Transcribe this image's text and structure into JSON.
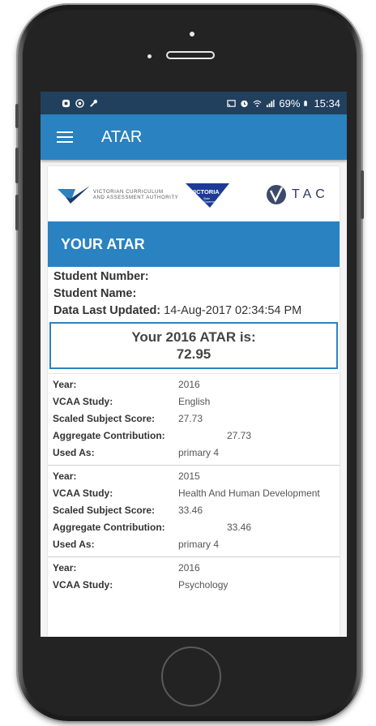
{
  "status_bar": {
    "battery": "69%",
    "time": "15:34"
  },
  "app_bar": {
    "title": "ATAR"
  },
  "logos": {
    "vcaa_line1": "VICTORIAN CURRICULUM",
    "vcaa_line2": "AND ASSESSMENT AUTHORITY",
    "victoria": "VICTORIA",
    "victoria_sub1": "State",
    "victoria_sub2": "Government",
    "tac": "TAC"
  },
  "section": {
    "title": "YOUR ATAR"
  },
  "student": {
    "number_label": "Student Number:",
    "name_label": "Student Name:",
    "updated_label": "Data Last Updated:",
    "updated_value": "14-Aug-2017 02:34:54 PM"
  },
  "atar": {
    "heading": "Your 2016 ATAR is:",
    "value": "72.95"
  },
  "labels": {
    "year": "Year:",
    "study": "VCAA Study:",
    "scaled": "Scaled Subject Score:",
    "aggregate": "Aggregate Contribution:",
    "used_as": "Used As:"
  },
  "subjects": [
    {
      "year": "2016",
      "study": "English",
      "scaled": "27.73",
      "aggregate": "27.73",
      "used_as": "primary 4"
    },
    {
      "year": "2015",
      "study": "Health And Human Development",
      "scaled": "33.46",
      "aggregate": "33.46",
      "used_as": "primary 4"
    },
    {
      "year": "2016",
      "study": "Psychology"
    }
  ],
  "colors": {
    "accent": "#2a82c0",
    "status_bar": "#21405e"
  }
}
